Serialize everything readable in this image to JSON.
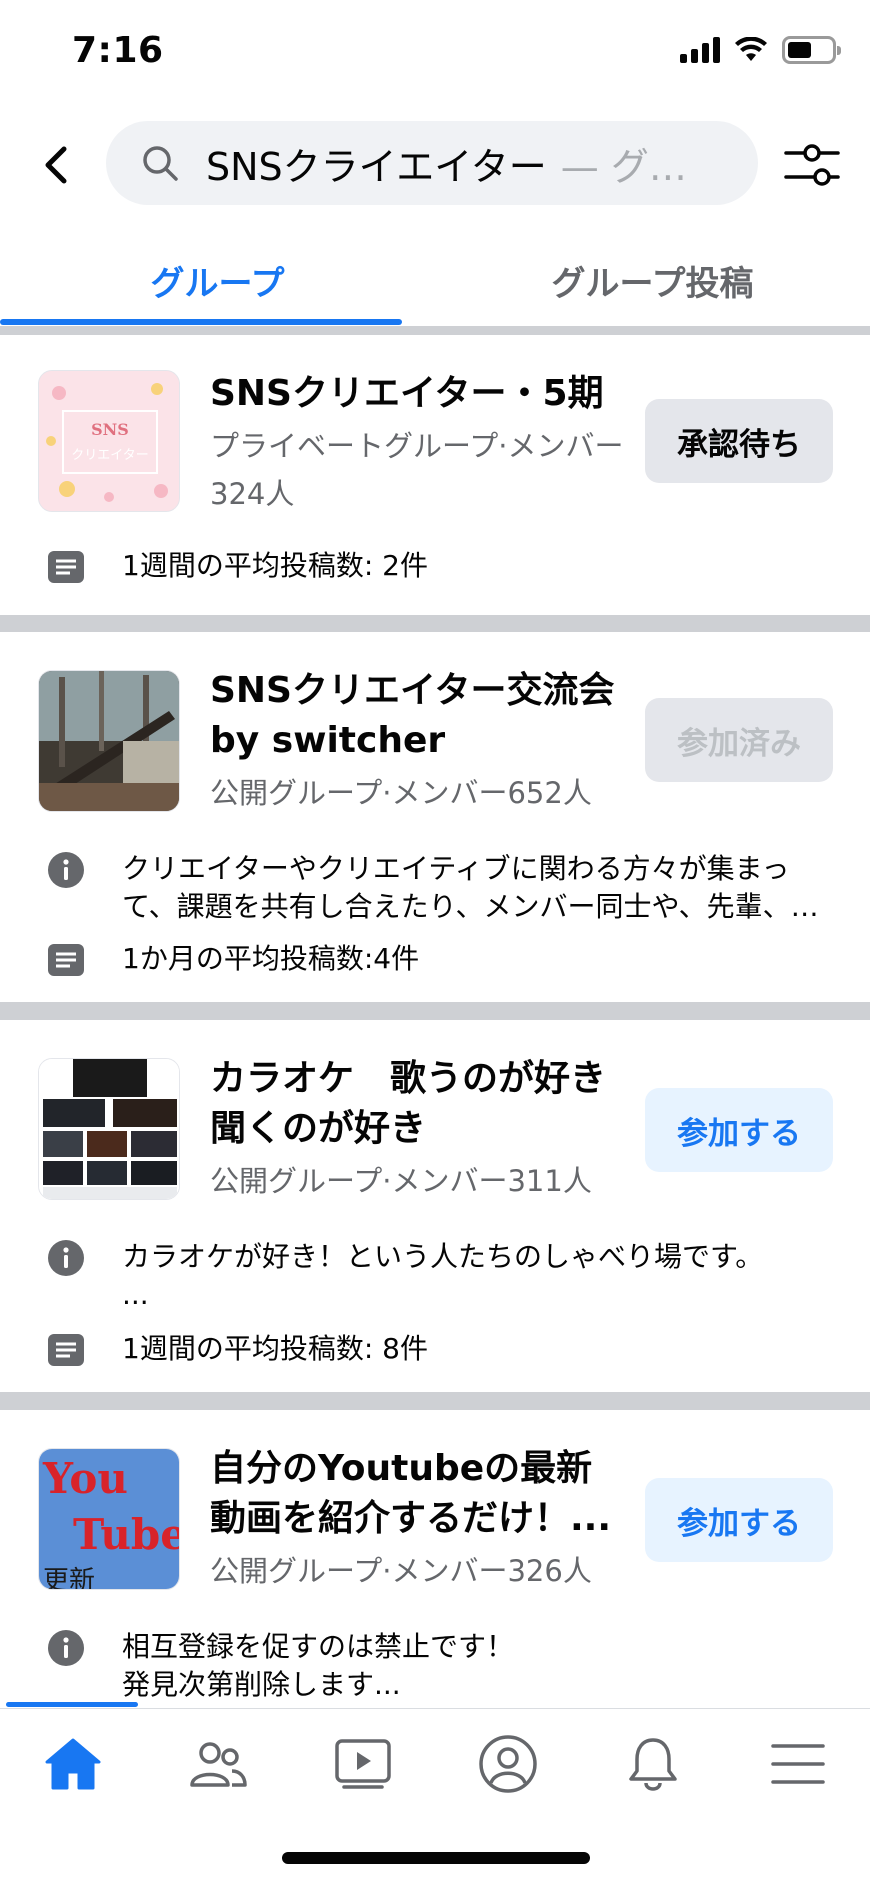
{
  "status_bar": {
    "time": "7:16",
    "battery_level": 0.55
  },
  "search": {
    "query": "SNSクライエイター",
    "suffix": "— グ…"
  },
  "tabs": [
    {
      "label": "グループ",
      "active": true
    },
    {
      "label": "グループ投稿",
      "active": false
    }
  ],
  "groups": [
    {
      "title_lines": [
        "SNSクリエイター・5期"
      ],
      "meta_lines": [
        "プライベートグループ·メンバー",
        "324人"
      ],
      "button": "承認待ち",
      "info": "",
      "posts": "1週間の平均投稿数: 2件",
      "thumb_text": [
        "SNS",
        "クリエイター"
      ]
    },
    {
      "title_lines": [
        "SNSクリエイター交流会",
        "by switcher"
      ],
      "meta_lines": [
        "公開グループ·メンバー652人"
      ],
      "button": "参加済み",
      "info_lines": [
        "クリエイターやクリエイティブに関わる方々が集まっ",
        "て、課題を共有し合えたり、メンバー同士や、先輩、…"
      ],
      "posts": "1か月の平均投稿数:4件"
    },
    {
      "title_lines": [
        "カラオケ　歌うのが好き",
        "聞くのが好き"
      ],
      "meta_lines": [
        "公開グループ·メンバー311人"
      ],
      "button": "参加する",
      "info_lines": [
        "カラオケが好き！という人たちのしゃべり場です。",
        "..."
      ],
      "posts": "1週間の平均投稿数: 8件"
    },
    {
      "title_lines": [
        "自分のYoutubeの最新",
        "動画を紹介するだけ！..."
      ],
      "meta_lines": [
        "公開グループ·メンバー326人"
      ],
      "button": "参加する",
      "info_lines": [
        "相互登録を促すのは禁止です！",
        "発見次第削除します..."
      ],
      "posts": "",
      "thumb_text": [
        "You",
        "Tube",
        "更新"
      ]
    }
  ],
  "nav": [
    "home-icon",
    "friends-icon",
    "watch-icon",
    "profile-icon",
    "notifications-icon",
    "menu-icon"
  ],
  "colors": {
    "accent": "#1877f2",
    "separator": "#ced0d4",
    "secondary_text": "#65676b"
  }
}
